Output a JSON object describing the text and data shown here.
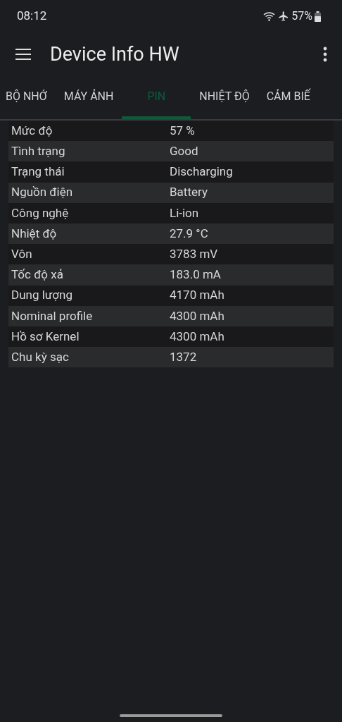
{
  "status_bar": {
    "time": "08:12",
    "battery": "57%"
  },
  "app_bar": {
    "title": "Device Info HW"
  },
  "tabs": [
    {
      "label": "BỘ NHỚ",
      "selected": false
    },
    {
      "label": "MÁY ẢNH",
      "selected": false
    },
    {
      "label": "PIN",
      "selected": true
    },
    {
      "label": "NHIỆT ĐỘ",
      "selected": false
    },
    {
      "label": "CẢM BIẾ",
      "selected": false
    }
  ],
  "rows": [
    {
      "label": "Mức độ",
      "value": "57 %"
    },
    {
      "label": "Tình trạng",
      "value": "Good"
    },
    {
      "label": "Trạng thái",
      "value": "Discharging"
    },
    {
      "label": "Nguồn điện",
      "value": "Battery"
    },
    {
      "label": "Công nghệ",
      "value": "Li-ion"
    },
    {
      "label": "Nhiệt độ",
      "value": "27.9 °C"
    },
    {
      "label": "Vôn",
      "value": "3783 mV"
    },
    {
      "label": "Tốc độ xả",
      "value": "183.0 mA"
    },
    {
      "label": "Dung lượng",
      "value": "4170 mAh"
    },
    {
      "label": "Nominal profile",
      "value": "4300 mAh"
    },
    {
      "label": "Hồ sơ Kernel",
      "value": "4300 mAh"
    },
    {
      "label": "Chu kỳ sạc",
      "value": "1372"
    }
  ]
}
